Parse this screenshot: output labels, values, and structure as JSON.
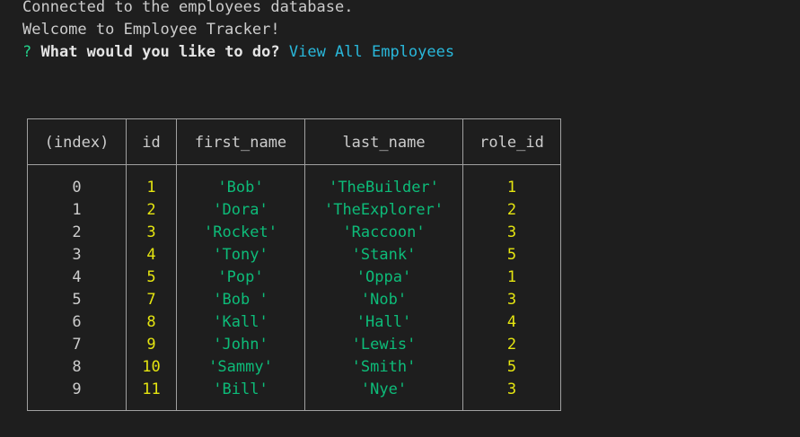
{
  "terminal": {
    "line1": "Connected to the employees database.",
    "line2": "Welcome to Employee Tracker!",
    "prompt_mark": "?",
    "question": "What would you like to do?",
    "answer": "View All Employees"
  },
  "table": {
    "headers": [
      "(index)",
      "id",
      "first_name",
      "last_name",
      "role_id"
    ],
    "rows": [
      {
        "index": "0",
        "id": "1",
        "first_name": "'Bob'",
        "last_name": "'TheBuilder'",
        "role_id": "1"
      },
      {
        "index": "1",
        "id": "2",
        "first_name": "'Dora'",
        "last_name": "'TheExplorer'",
        "role_id": "2"
      },
      {
        "index": "2",
        "id": "3",
        "first_name": "'Rocket'",
        "last_name": "'Raccoon'",
        "role_id": "3"
      },
      {
        "index": "3",
        "id": "4",
        "first_name": "'Tony'",
        "last_name": "'Stank'",
        "role_id": "5"
      },
      {
        "index": "4",
        "id": "5",
        "first_name": "'Pop'",
        "last_name": "'Oppa'",
        "role_id": "1"
      },
      {
        "index": "5",
        "id": "7",
        "first_name": "'Bob '",
        "last_name": "'Nob'",
        "role_id": "3"
      },
      {
        "index": "6",
        "id": "8",
        "first_name": "'Kall'",
        "last_name": "'Hall'",
        "role_id": "4"
      },
      {
        "index": "7",
        "id": "9",
        "first_name": "'John'",
        "last_name": "'Lewis'",
        "role_id": "2"
      },
      {
        "index": "8",
        "id": "10",
        "first_name": "'Sammy'",
        "last_name": "'Smith'",
        "role_id": "5"
      },
      {
        "index": "9",
        "id": "11",
        "first_name": "'Bill'",
        "last_name": "'Nye'",
        "role_id": "3"
      }
    ]
  },
  "colors": {
    "background": "#1e1e1e",
    "text": "#cccccc",
    "prompt_green": "#23d18b",
    "answer_cyan": "#29b8db",
    "number_yellow": "#e5e510",
    "string_green": "#0dbc79",
    "border": "#a0a0a0"
  }
}
